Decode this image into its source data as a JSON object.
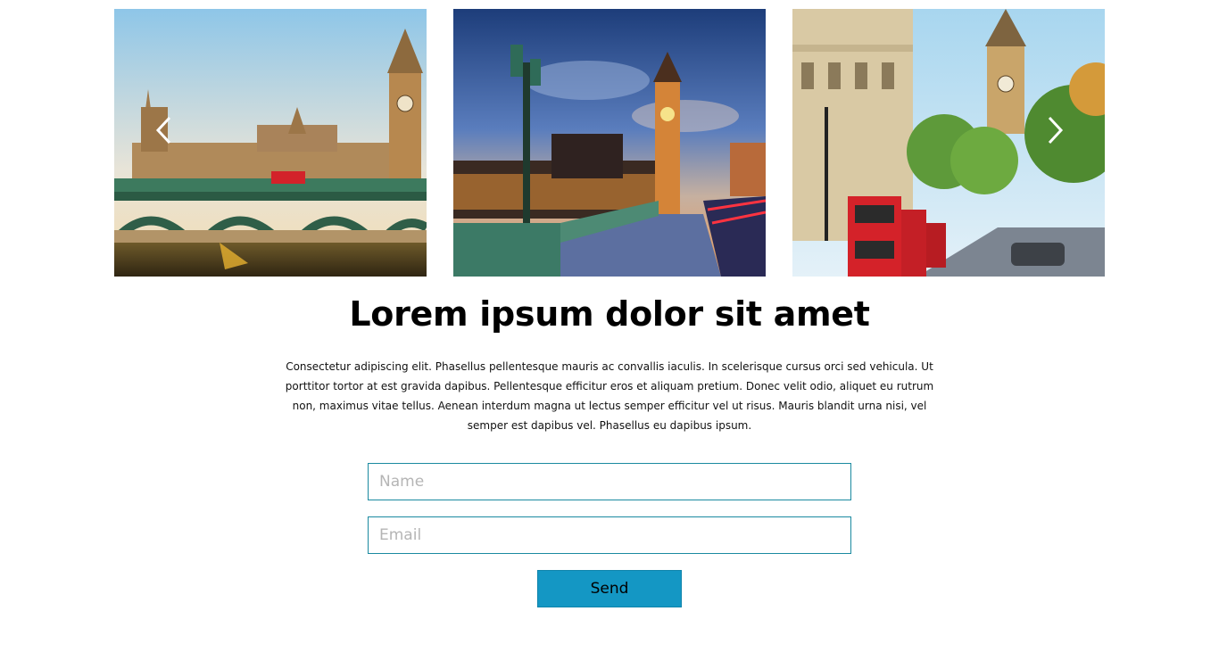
{
  "carousel": {
    "slides": [
      {
        "image": "london-westminster-bridge-photo"
      },
      {
        "image": "london-big-ben-dusk-photo"
      },
      {
        "image": "london-red-bus-street-photo"
      }
    ],
    "prev_icon": "chevron-left-icon",
    "next_icon": "chevron-right-icon"
  },
  "content": {
    "title": "Lorem ipsum dolor sit amet",
    "description": "Consectetur adipiscing elit. Phasellus pellentesque mauris ac convallis iaculis. In scelerisque cursus orci sed vehicula. Ut porttitor tortor at est gravida dapibus. Pellentesque efficitur eros et aliquam pretium. Donec velit odio, aliquet eu rutrum non, maximus vitae tellus. Aenean interdum magna ut lectus semper efficitur vel ut risus. Mauris blandit urna nisi, vel semper est dapibus vel. Phasellus eu dapibus ipsum."
  },
  "form": {
    "name_placeholder": "Name",
    "name_value": "",
    "email_placeholder": "Email",
    "email_value": "",
    "send_label": "Send"
  },
  "colors": {
    "accent": "#1497c4",
    "field_border": "#1a8aa0"
  }
}
